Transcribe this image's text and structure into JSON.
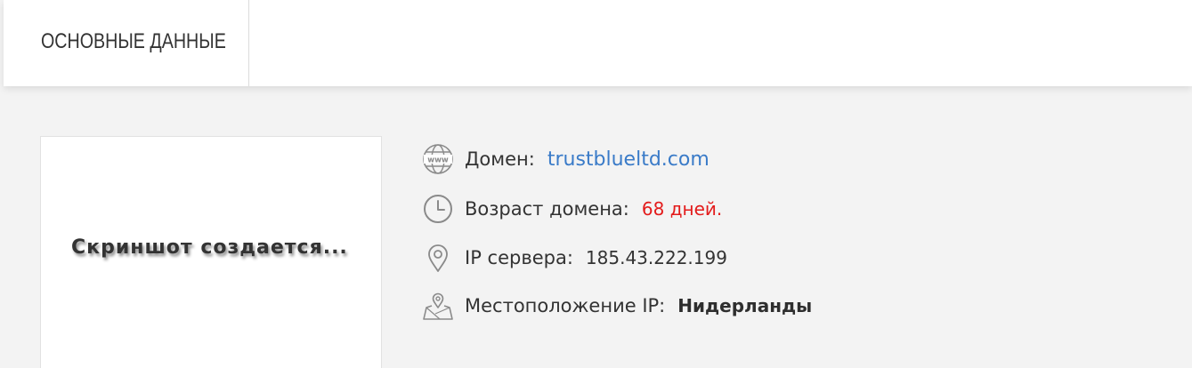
{
  "header": {
    "title": "ОСНОВНЫЕ ДАННЫЕ"
  },
  "screenshot": {
    "placeholder_text": "Скриншот создается..."
  },
  "info": {
    "domain": {
      "icon": "www-globe-icon",
      "label": "Домен:",
      "value": "trustblueltd.com"
    },
    "age": {
      "icon": "clock-icon",
      "label": "Возраст домена:",
      "value": "68 дней."
    },
    "ip": {
      "icon": "map-pin-icon",
      "label": "IP сервера:",
      "value": "185.43.222.199"
    },
    "location": {
      "icon": "map-location-icon",
      "label": "Местоположение IP:",
      "value": "Нидерланды"
    }
  },
  "colors": {
    "link": "#3a7bc8",
    "alert": "#e31b1b",
    "text": "#333333",
    "icon": "#8a8a8a"
  }
}
